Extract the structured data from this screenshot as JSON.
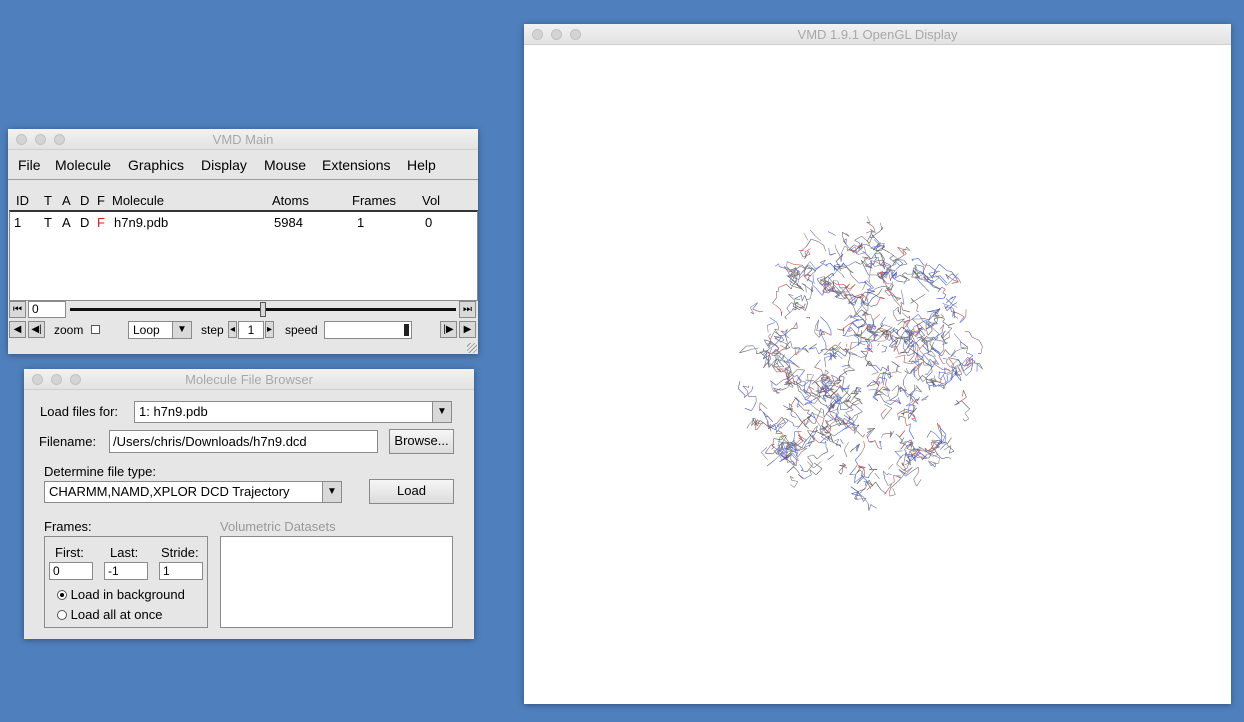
{
  "main_window": {
    "title": "VMD Main",
    "menu": [
      "File",
      "Molecule",
      "Graphics",
      "Display",
      "Mouse",
      "Extensions",
      "Help"
    ],
    "columns": {
      "id": "ID",
      "t": "T",
      "a": "A",
      "d": "D",
      "f": "F",
      "molecule": "Molecule",
      "atoms": "Atoms",
      "frames": "Frames",
      "vol": "Vol"
    },
    "molecules": [
      {
        "id": "1",
        "t": "T",
        "a": "A",
        "d": "D",
        "f": "F",
        "name": "h7n9.pdb",
        "atoms": "5984",
        "frames": "1",
        "vol": "0"
      }
    ],
    "frame_value": "0",
    "zoom_label": "zoom",
    "loop_mode": "Loop",
    "step_label": "step",
    "step_value": "1",
    "speed_label": "speed"
  },
  "display_window": {
    "title": "VMD 1.9.1 OpenGL Display",
    "content": "protein-wireframe"
  },
  "file_browser": {
    "title": "Molecule File Browser",
    "load_for_label": "Load files for:",
    "load_for_value": "1: h7n9.pdb",
    "filename_label": "Filename:",
    "filename_value": "/Users/chris/Downloads/h7n9.dcd",
    "browse_label": "Browse...",
    "filetype_label": "Determine file type:",
    "filetype_value": "CHARMM,NAMD,XPLOR DCD Trajectory",
    "load_label": "Load",
    "frames_label": "Frames:",
    "first_label": "First:",
    "first_value": "0",
    "last_label": "Last:",
    "last_value": "-1",
    "stride_label": "Stride:",
    "stride_value": "1",
    "radio_background": "Load in background",
    "radio_all": "Load all at once",
    "volumetric_label": "Volumetric Datasets"
  },
  "colors": {
    "desktop": "#4f7fbc",
    "fixed_flag": "#cc2222"
  }
}
